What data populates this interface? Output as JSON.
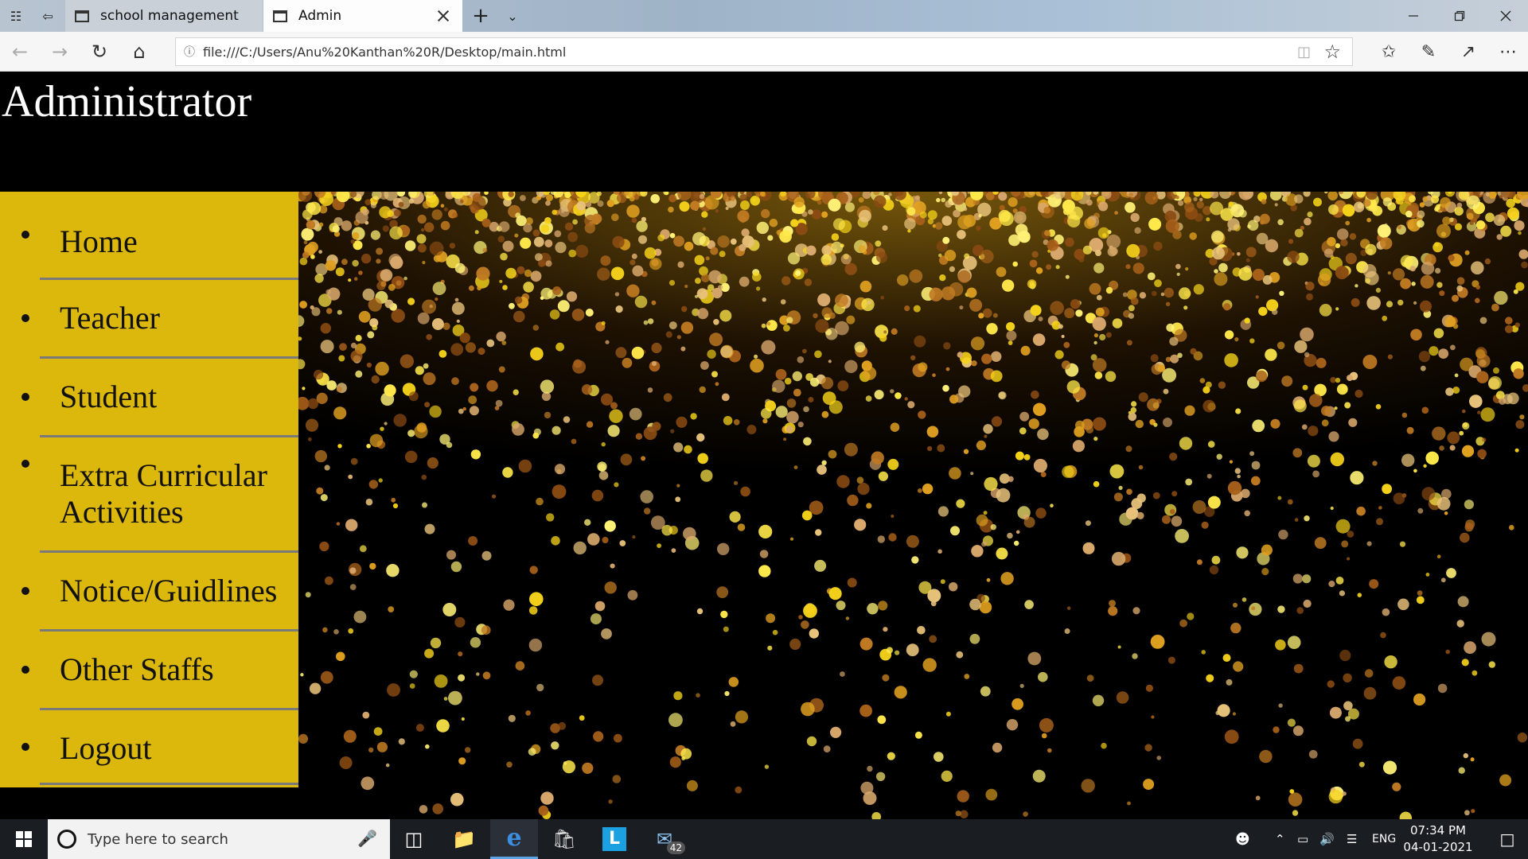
{
  "browser": {
    "tabs": [
      {
        "label": "school management",
        "active": false
      },
      {
        "label": "Admin",
        "active": true
      }
    ],
    "url": "file:///C:/Users/Anu%20Kanthan%20R/Desktop/main.html"
  },
  "page": {
    "title": "Administrator",
    "menu": [
      "Home",
      "Teacher",
      "Student",
      "Extra Curricular Activities",
      "Notice/Guidlines",
      "Other Staffs",
      "Logout"
    ],
    "colors": {
      "header_bg": "#000000",
      "sidebar_bg": "#dcb80c",
      "sparkle_gold": "#f5d21a",
      "sparkle_bronze": "#a8611a"
    }
  },
  "taskbar": {
    "search_placeholder": "Type here to search",
    "mail_badge": "42",
    "language": "ENG",
    "time": "07:34 PM",
    "date": "04-01-2021"
  }
}
